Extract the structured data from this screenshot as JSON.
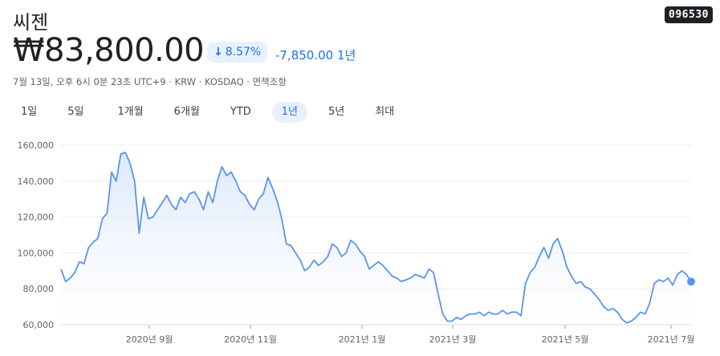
{
  "stock": {
    "name": "씨젠",
    "ticker": "096530",
    "price": "₩83,800.00",
    "change_percent": "8.57%",
    "change_abs": "-7,850.00",
    "change_period": "1년",
    "meta": "7월 13일, 오후 6시 0분 23초 UTC+9 · KRW · KOSDAQ · 면책조항"
  },
  "tabs": [
    {
      "label": "1일"
    },
    {
      "label": "5일"
    },
    {
      "label": "1개월"
    },
    {
      "label": "6개월"
    },
    {
      "label": "YTD"
    },
    {
      "label": "1년",
      "active": true
    },
    {
      "label": "5년"
    },
    {
      "label": "최대"
    }
  ],
  "colors": {
    "accent": "#1a73e8",
    "line": "#5b95e8",
    "fill_top": "#d7e5fb"
  },
  "chart_data": {
    "type": "area",
    "y_ticks": [
      "160,000",
      "140,000",
      "120,000",
      "100,000",
      "80,000",
      "60,000"
    ],
    "ylim": [
      60000,
      160000
    ],
    "x_ticks": [
      "2020년 9월",
      "2020년 11월",
      "2021년 1월",
      "2021년 3월",
      "2021년 5월",
      "2021년 7월"
    ],
    "grid": true,
    "values": [
      91000,
      84000,
      86000,
      89000,
      95000,
      94000,
      103000,
      106000,
      108000,
      119000,
      122000,
      145000,
      140000,
      155000,
      156000,
      150000,
      140000,
      111000,
      131000,
      119000,
      120000,
      124000,
      128000,
      132000,
      127000,
      124000,
      131000,
      128000,
      133000,
      134000,
      130000,
      124000,
      134000,
      128000,
      140000,
      148000,
      143000,
      145000,
      140000,
      134000,
      132000,
      127000,
      124000,
      130000,
      133000,
      142000,
      136000,
      129000,
      119000,
      105000,
      104000,
      100000,
      96000,
      90000,
      92000,
      96000,
      93000,
      95000,
      98000,
      105000,
      103000,
      98000,
      100000,
      107000,
      105000,
      101000,
      98000,
      91000,
      93000,
      95000,
      93000,
      90000,
      87000,
      86000,
      84000,
      85000,
      86000,
      88000,
      87000,
      86000,
      91000,
      89000,
      77000,
      66000,
      62000,
      62000,
      64000,
      63000,
      65000,
      66000,
      66000,
      67000,
      65000,
      67000,
      66000,
      66000,
      68000,
      66000,
      67000,
      67000,
      65000,
      83000,
      89000,
      92000,
      98000,
      103000,
      97000,
      105000,
      108000,
      101000,
      92000,
      87000,
      83000,
      84000,
      81000,
      80000,
      77000,
      74000,
      70000,
      68000,
      69000,
      67000,
      63000,
      61000,
      62000,
      64000,
      67000,
      66000,
      72000,
      83000,
      85000,
      84000,
      86000,
      82000,
      88000,
      90000,
      88000,
      84000
    ]
  }
}
